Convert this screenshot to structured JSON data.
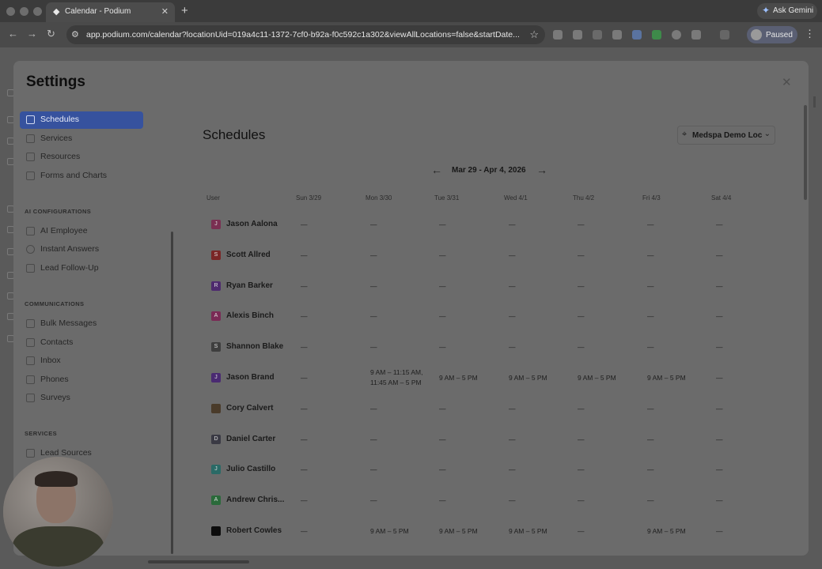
{
  "browser": {
    "tab_title": "Calendar - Podium",
    "url": "app.podium.com/calendar?locationUid=019a4c11-1372-7cf0-b92a-f0c592c1a302&viewAllLocations=false&startDate...",
    "gemini_label": "Ask Gemini",
    "profile_status": "Paused"
  },
  "modal": {
    "title": "Settings"
  },
  "sidebar": {
    "top_items": [
      {
        "label": "Schedules",
        "icon": "calendar-icon",
        "active": true
      },
      {
        "label": "Services",
        "icon": "tag-icon"
      },
      {
        "label": "Resources",
        "icon": "list-icon"
      },
      {
        "label": "Forms and Charts",
        "icon": "document-icon"
      }
    ],
    "ai_section": "AI CONFIGURATIONS",
    "ai_items": [
      {
        "label": "AI Employee",
        "icon": "sparkle-icon"
      },
      {
        "label": "Instant Answers",
        "icon": "help-icon"
      },
      {
        "label": "Lead Follow-Up",
        "icon": "lightning-icon"
      }
    ],
    "comm_section": "COMMUNICATIONS",
    "comm_items": [
      {
        "label": "Bulk Messages",
        "icon": "megaphone-icon"
      },
      {
        "label": "Contacts",
        "icon": "contacts-icon"
      },
      {
        "label": "Inbox",
        "icon": "inbox-icon"
      },
      {
        "label": "Phones",
        "icon": "phone-icon"
      },
      {
        "label": "Surveys",
        "icon": "survey-icon"
      }
    ],
    "services_section": "SERVICES",
    "services_items": [
      {
        "label": "Lead Sources",
        "icon": "lead-sources-icon"
      }
    ]
  },
  "main": {
    "title": "Schedules",
    "location": "Medspa Demo Loc",
    "date_range": "Mar 29 - Apr 4, 2026",
    "columns": [
      "User",
      "Sun 3/29",
      "Mon 3/30",
      "Tue 3/31",
      "Wed 4/1",
      "Thu 4/2",
      "Fri 4/3",
      "Sat 4/4"
    ],
    "rows": [
      {
        "initial": "J",
        "color": "#7a2f52",
        "name": "Jason Aalona",
        "days": [
          "—",
          "—",
          "—",
          "—",
          "—",
          "—",
          "—"
        ]
      },
      {
        "initial": "S",
        "color": "#7a2626",
        "name": "Scott Allred",
        "days": [
          "—",
          "—",
          "—",
          "—",
          "—",
          "—",
          "—"
        ]
      },
      {
        "initial": "R",
        "color": "#4e2a6e",
        "name": "Ryan Barker",
        "days": [
          "—",
          "—",
          "—",
          "—",
          "—",
          "—",
          "—"
        ]
      },
      {
        "initial": "A",
        "color": "#7a2a55",
        "name": "Alexis Binch",
        "days": [
          "—",
          "—",
          "—",
          "—",
          "—",
          "—",
          "—"
        ]
      },
      {
        "initial": "S",
        "color": "#3e3e3e",
        "name": "Shannon Blake",
        "days": [
          "—",
          "—",
          "—",
          "—",
          "—",
          "—",
          "—"
        ]
      },
      {
        "initial": "J",
        "color": "#4a2a72",
        "name": "Jason Brand",
        "days": [
          "—",
          "9 AM – 11:15 AM,\n11:45 AM – 5 PM",
          "9 AM – 5 PM",
          "9 AM – 5 PM",
          "9 AM – 5 PM",
          "9 AM – 5 PM",
          "—"
        ]
      },
      {
        "initial": "",
        "color": "#4a3b2a",
        "name": "Cory Calvert",
        "days": [
          "—",
          "—",
          "—",
          "—",
          "—",
          "—",
          "—"
        ]
      },
      {
        "initial": "D",
        "color": "#3a3a44",
        "name": "Daniel Carter",
        "days": [
          "—",
          "—",
          "—",
          "—",
          "—",
          "—",
          "—"
        ]
      },
      {
        "initial": "J",
        "color": "#2a6a66",
        "name": "Julio Castillo",
        "days": [
          "—",
          "—",
          "—",
          "—",
          "—",
          "—",
          "—"
        ]
      },
      {
        "initial": "A",
        "color": "#2a6a3a",
        "name": "Andrew Chris...",
        "days": [
          "—",
          "—",
          "—",
          "—",
          "—",
          "—",
          "—"
        ]
      },
      {
        "initial": "",
        "color": "#0c0c0c",
        "name": "Robert Cowles",
        "days": [
          "—",
          "9 AM – 5 PM",
          "9 AM – 5 PM",
          "9 AM – 5 PM",
          "—",
          "9 AM – 5 PM",
          "—"
        ]
      }
    ]
  }
}
